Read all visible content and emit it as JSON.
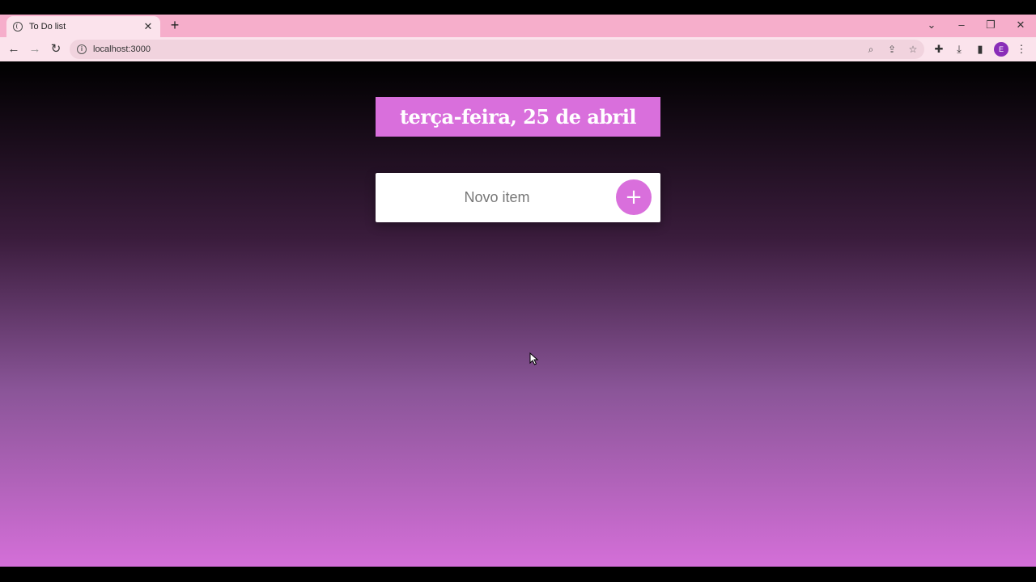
{
  "browser": {
    "tab_title": "To Do list",
    "tab_close": "✕",
    "new_tab": "+",
    "url": "localhost:3000",
    "profile_initial": "E",
    "window_controls": {
      "dropdown": "⌄",
      "minimize": "–",
      "restore": "❐",
      "close": "✕"
    }
  },
  "page": {
    "date_heading": "terça-feira, 25 de abril",
    "new_item_placeholder": "Novo item",
    "add_button_label": "+"
  },
  "colors": {
    "accent": "#d96fdc",
    "tabstrip": "#f6aecb",
    "gradient_top": "#000000",
    "gradient_bottom": "#d46fd8"
  }
}
